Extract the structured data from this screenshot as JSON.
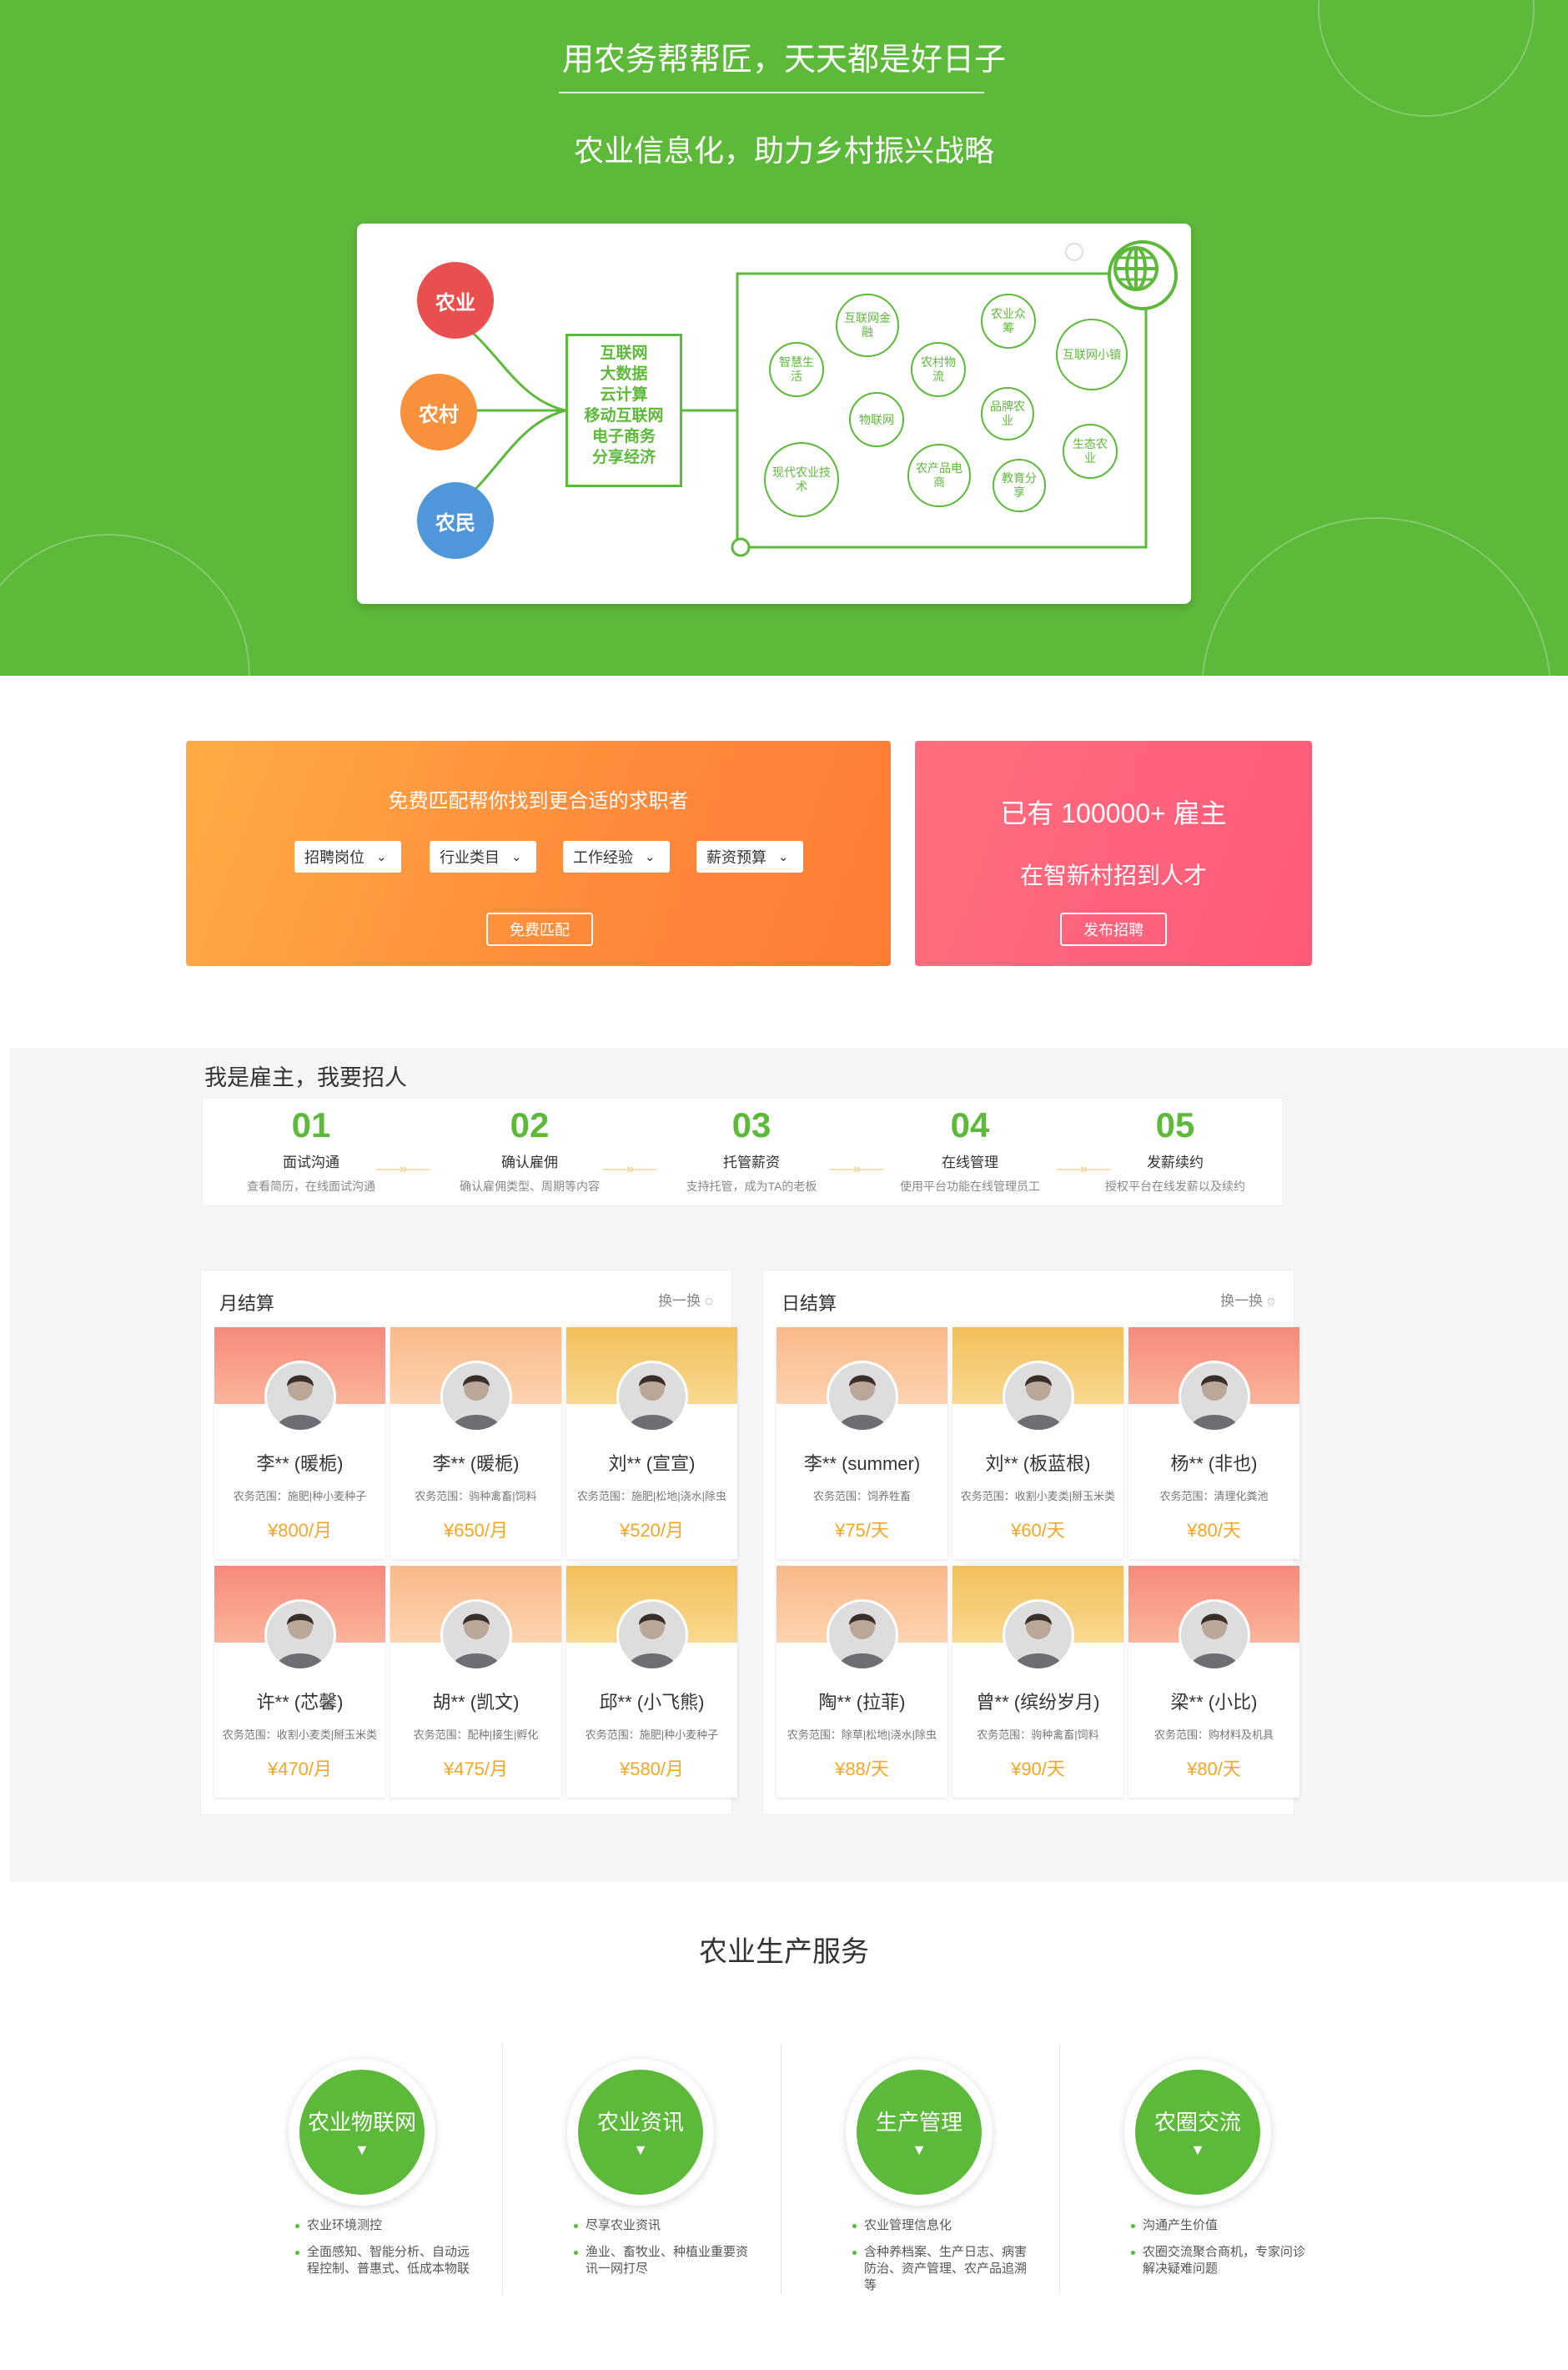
{
  "hero": {
    "title": "用农务帮帮匠，天天都是好日子",
    "subtitle": "农业信息化，助力乡村振兴战略",
    "pillars": [
      "农业",
      "农村",
      "农民"
    ],
    "tech": [
      "互联网",
      "大数据",
      "云计算",
      "移动互联网",
      "电子商务",
      "分享经济"
    ],
    "bubbles": [
      "互联网金融",
      "农业众筹",
      "互联网小镇",
      "智慧生活",
      "农村物流",
      "物联网",
      "品牌农业",
      "生态农业",
      "现代农业技术",
      "农产品电商",
      "教育分享"
    ]
  },
  "match": {
    "title": "免费匹配帮你找到更合适的求职者",
    "selects": [
      "招聘岗位",
      "行业类目",
      "工作经验",
      "薪资预算"
    ],
    "button": "免费匹配"
  },
  "employer": {
    "line1": "已有 100000+ 雇主",
    "line2": "在智新村招到人才",
    "button": "发布招聘"
  },
  "steps": {
    "title": "我是雇主，我要招人",
    "items": [
      {
        "num": "01",
        "title": "面试沟通",
        "desc": "查看简历，在线面试沟通"
      },
      {
        "num": "02",
        "title": "确认雇佣",
        "desc": "确认雇佣类型、周期等内容"
      },
      {
        "num": "03",
        "title": "托管薪资",
        "desc": "支持托管，成为TA的老板"
      },
      {
        "num": "04",
        "title": "在线管理",
        "desc": "使用平台功能在线管理员工"
      },
      {
        "num": "05",
        "title": "发薪续约",
        "desc": "授权平台在线发薪以及续约"
      }
    ]
  },
  "monthly": {
    "title": "月结算",
    "switch": "换一换",
    "workers": [
      {
        "name": "李** (暖栀)",
        "scope": "农务范围：施肥|种小麦种子",
        "price": "¥800/月"
      },
      {
        "name": "李** (暖栀)",
        "scope": "农务范围：驹种禽畜|饲料",
        "price": "¥650/月"
      },
      {
        "name": "刘** (宣宣)",
        "scope": "农务范围：施肥|松地|浇水|除虫",
        "price": "¥520/月"
      },
      {
        "name": "许** (芯馨)",
        "scope": "农务范围：收割小麦类|掰玉米类",
        "price": "¥470/月"
      },
      {
        "name": "胡** (凯文)",
        "scope": "农务范围：配种|接生|孵化",
        "price": "¥475/月"
      },
      {
        "name": "邱** (小飞熊)",
        "scope": "农务范围：施肥|种小麦种子",
        "price": "¥580/月"
      }
    ]
  },
  "daily": {
    "title": "日结算",
    "switch": "换一换",
    "workers": [
      {
        "name": "李** (summer)",
        "scope": "农务范围：饲养牲畜",
        "price": "¥75/天"
      },
      {
        "name": "刘** (板蓝根)",
        "scope": "农务范围：收割小麦类|掰玉米类",
        "price": "¥60/天"
      },
      {
        "name": "杨** (非也)",
        "scope": "农务范围：清理化粪池",
        "price": "¥80/天"
      },
      {
        "name": "陶** (拉菲)",
        "scope": "农务范围：除草|松地|浇水|除虫",
        "price": "¥88/天"
      },
      {
        "name": "曾** (缤纷岁月)",
        "scope": "农务范围：驹种禽畜|饲料",
        "price": "¥90/天"
      },
      {
        "name": "梁** (小比)",
        "scope": "农务范围：购材料及机具",
        "price": "¥80/天"
      }
    ]
  },
  "services": {
    "title": "农业生产服务",
    "items": [
      {
        "name": "农业物联网",
        "points": [
          "农业环境测控",
          "全面感知、智能分析、自动远程控制、普惠式、低成本物联"
        ]
      },
      {
        "name": "农业资讯",
        "points": [
          "尽享农业资讯",
          "渔业、畜牧业、种植业重要资讯一网打尽"
        ]
      },
      {
        "name": "生产管理",
        "points": [
          "农业管理信息化",
          "含种养档案、生产日志、病害防治、资产管理、农产品追溯等"
        ]
      },
      {
        "name": "农圈交流",
        "points": [
          "沟通产生价值",
          "农圈交流聚合商机，专家问诊解决疑难问题"
        ]
      }
    ]
  },
  "colors": {
    "green": "#5db93a",
    "orange": "#ff8a3a",
    "pink": "#ff5a7a",
    "gold": "#f5a623"
  }
}
